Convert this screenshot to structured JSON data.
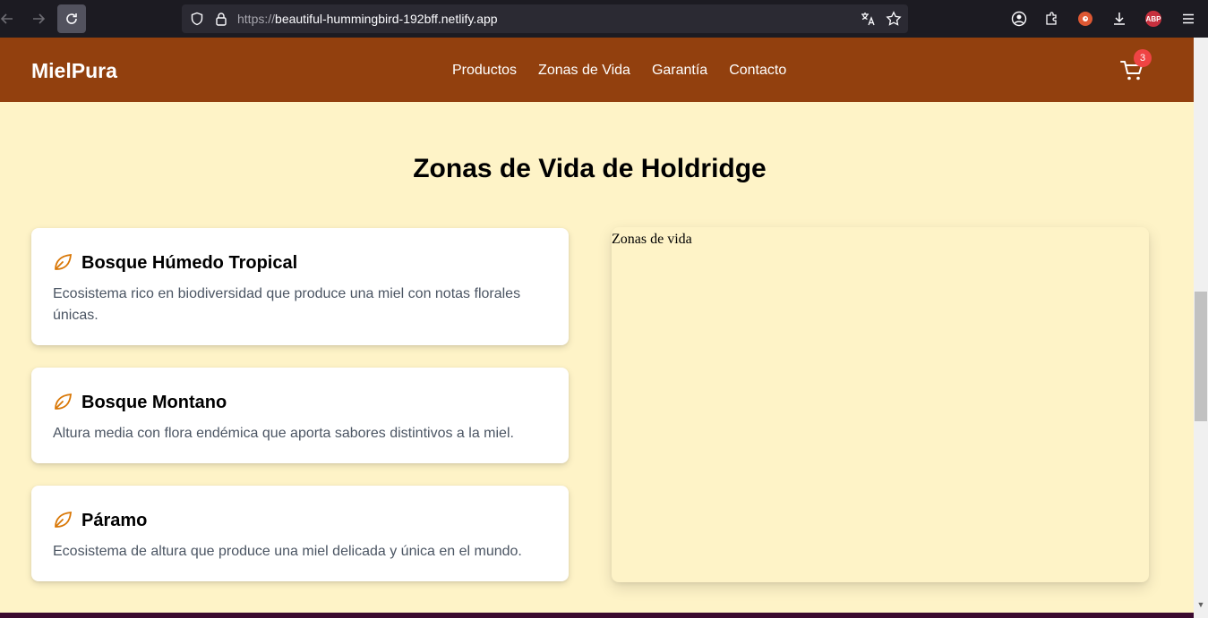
{
  "browser": {
    "url_scheme": "https://",
    "url_host": "beautiful-hummingbird-192bff.netlify.app"
  },
  "header": {
    "logo": "MielPura",
    "nav": [
      {
        "label": "Productos"
      },
      {
        "label": "Zonas de Vida"
      },
      {
        "label": "Garantía"
      },
      {
        "label": "Contacto"
      }
    ],
    "cart_count": "3"
  },
  "section": {
    "title": "Zonas de Vida de Holdridge",
    "zones": [
      {
        "title": "Bosque Húmedo Tropical",
        "description": "Ecosistema rico en biodiversidad que produce una miel con notas florales únicas."
      },
      {
        "title": "Bosque Montano",
        "description": "Altura media con flora endémica que aporta sabores distintivos a la miel."
      },
      {
        "title": "Páramo",
        "description": "Ecosistema de altura que produce una miel delicada y única en el mundo."
      }
    ],
    "map_alt": "Zonas de vida"
  },
  "colors": {
    "header_bg": "#92400e",
    "page_bg": "#fef3c7",
    "accent_icon": "#d97706",
    "badge": "#ef4444"
  },
  "icons": [
    "back-arrow-icon",
    "forward-arrow-icon",
    "reload-icon",
    "shield-icon",
    "lock-icon",
    "translate-icon",
    "star-icon",
    "account-icon",
    "extensions-icon",
    "duckduckgo-icon",
    "download-icon",
    "adblock-icon",
    "menu-icon",
    "leaf-icon",
    "cart-icon"
  ]
}
